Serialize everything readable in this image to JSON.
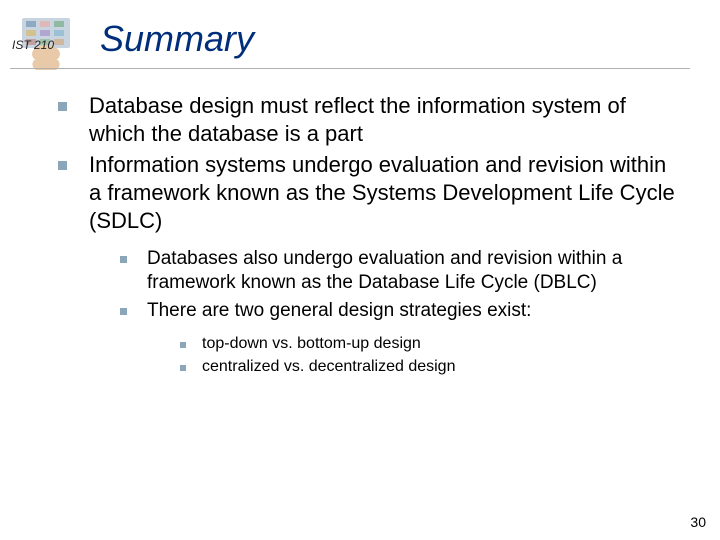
{
  "header": {
    "course_label": "IST 210",
    "title": "Summary"
  },
  "bullets_lvl1": [
    "Database design must reflect the information system of which the database is a part",
    "Information systems undergo evaluation and revision within a framework known as the Systems Development Life Cycle (SDLC)"
  ],
  "bullets_lvl2": [
    "Databases also undergo evaluation and revision within a framework known as the Database Life Cycle (DBLC)",
    "There are two general design strategies exist:"
  ],
  "bullets_lvl3": [
    "top-down vs. bottom-up design",
    "centralized vs. decentralized design"
  ],
  "page_number": "30"
}
